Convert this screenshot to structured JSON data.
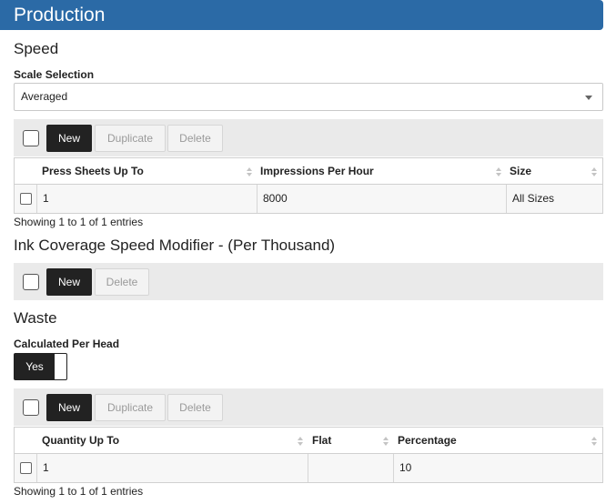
{
  "panel": {
    "title": "Production"
  },
  "speed": {
    "title": "Speed",
    "scale_label": "Scale Selection",
    "scale_value": "Averaged",
    "toolbar": {
      "new": "New",
      "duplicate": "Duplicate",
      "delete": "Delete"
    },
    "columns": [
      "Press Sheets Up To",
      "Impressions Per Hour",
      "Size"
    ],
    "rows": [
      [
        "1",
        "8000",
        "All Sizes"
      ]
    ],
    "info": "Showing 1 to 1 of 1 entries"
  },
  "ink": {
    "title": "Ink Coverage Speed Modifier - (Per Thousand)",
    "toolbar": {
      "new": "New",
      "delete": "Delete"
    }
  },
  "waste": {
    "title": "Waste",
    "calc_label": "Calculated Per Head",
    "toggle_label": "Yes",
    "toolbar": {
      "new": "New",
      "duplicate": "Duplicate",
      "delete": "Delete"
    },
    "columns": [
      "Quantity Up To",
      "Flat",
      "Percentage"
    ],
    "rows": [
      [
        "1",
        "",
        "10"
      ]
    ],
    "info": "Showing 1 to 1 of 1 entries"
  },
  "colors": {
    "header": "#2b6aa6",
    "dark_button": "#222222",
    "toolbar_bg": "#eaeaea"
  }
}
